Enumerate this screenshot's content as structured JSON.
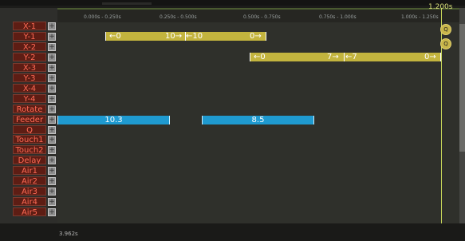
{
  "playhead": {
    "label": "1.200s"
  },
  "ruler": {
    "labels": [
      "0.000s - 0.250s",
      "0.250s - 0.500s",
      "0.500s - 0.750s",
      "0.750s - 1.000s",
      "1.000s - 1.250s"
    ]
  },
  "rows": [
    {
      "label": "X-1",
      "button": "+"
    },
    {
      "label": "Y-1",
      "button": "+"
    },
    {
      "label": "X-2",
      "button": "+"
    },
    {
      "label": "Y-2",
      "button": "+"
    },
    {
      "label": "X-3",
      "button": "+"
    },
    {
      "label": "Y-3",
      "button": "+"
    },
    {
      "label": "X-4",
      "button": "+"
    },
    {
      "label": "Y-4",
      "button": "+"
    },
    {
      "label": "Rotate",
      "button": "+"
    },
    {
      "label": "Feeder",
      "button": "+"
    },
    {
      "label": "Q",
      "button": "+"
    },
    {
      "label": "Touch1",
      "button": "+"
    },
    {
      "label": "Touch2",
      "button": "+"
    },
    {
      "label": "Delay",
      "button": "+"
    },
    {
      "label": "Air1",
      "button": "+"
    },
    {
      "label": "Air2",
      "button": "+"
    },
    {
      "label": "Air3",
      "button": "+"
    },
    {
      "label": "Air4",
      "button": "+"
    },
    {
      "label": "Air5",
      "button": "+"
    }
  ],
  "bars": {
    "y1": {
      "seg1_start": "←0",
      "seg1_end": "10→",
      "seg2_start": "←10",
      "seg2_end": "0→"
    },
    "y2": {
      "seg1_start": "←0",
      "seg1_end": "7→",
      "seg2_start": "←7",
      "seg2_end": "0→"
    },
    "feeder": {
      "bar1": "10.3",
      "bar2": "8.5"
    }
  },
  "side_buttons": [
    "Q",
    "Q"
  ],
  "bottom": {
    "label": "3.962s"
  },
  "colors": {
    "row_label_bg": "#5d1d14",
    "row_label_text": "#ff6a55",
    "axis_bar": "#c3b43e",
    "feeder_bar": "#1f9ad0",
    "playhead": "#c8d65a"
  }
}
